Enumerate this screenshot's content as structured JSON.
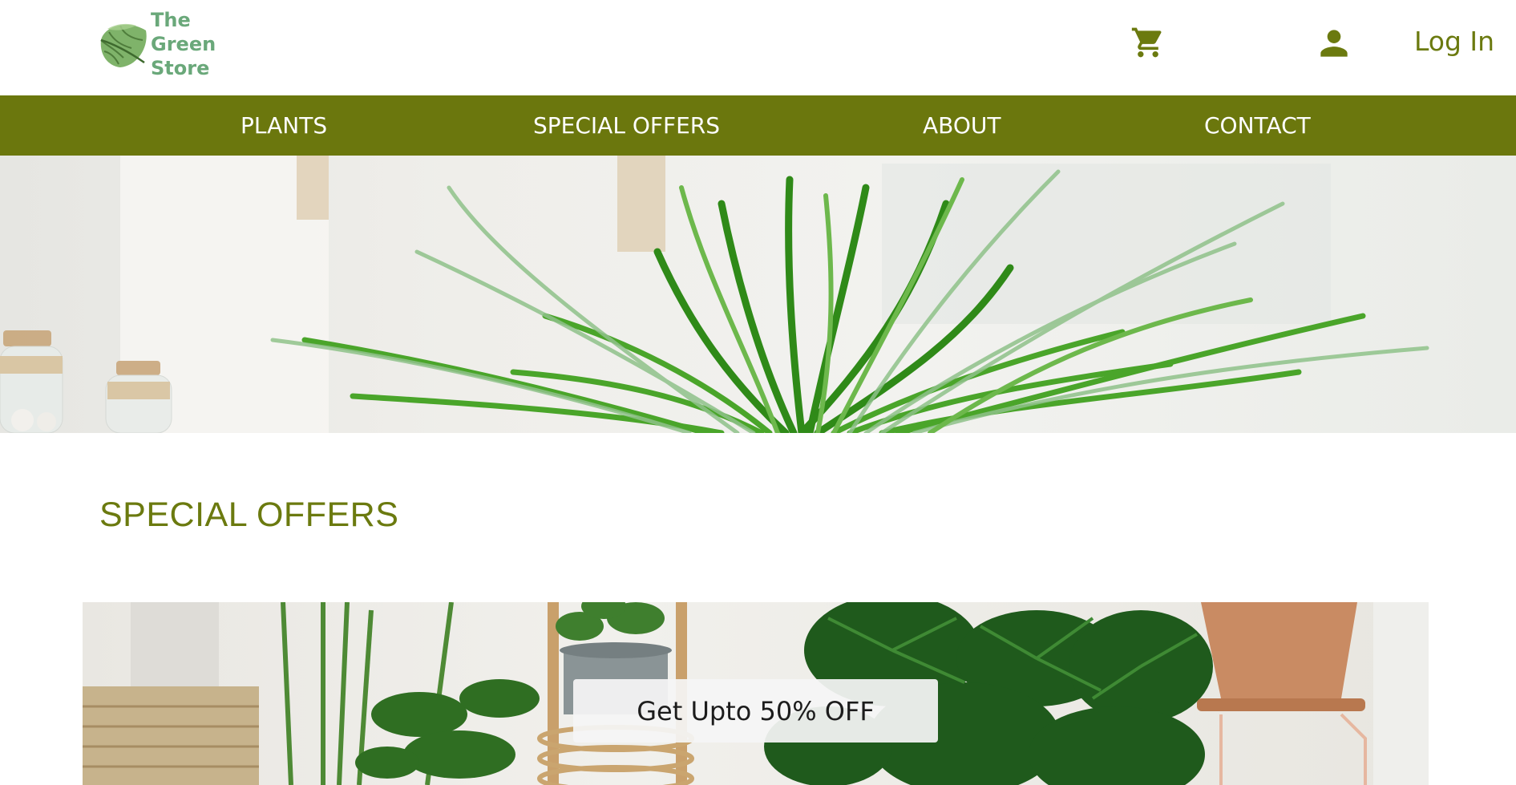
{
  "brand": {
    "name_lines": [
      "The",
      "Green",
      "Store"
    ],
    "color": "#6aa87a",
    "icon": "leaf-logo-icon"
  },
  "header": {
    "cart_icon": "shopping-cart-icon",
    "user_icon": "user-account-icon",
    "login_label": "Log In",
    "accent_color": "#6b7a0f"
  },
  "nav": {
    "background": "#6b770d",
    "items": [
      {
        "label": "PLANTS"
      },
      {
        "label": "SPECIAL OFFERS"
      },
      {
        "label": "ABOUT"
      },
      {
        "label": "CONTACT"
      }
    ]
  },
  "hero": {
    "image": "palm-plant-hero-image"
  },
  "special_offers": {
    "title": "SPECIAL OFFERS",
    "banner_image": "houseplants-banner-image",
    "badge_text": "Get Upto 50% OFF"
  }
}
